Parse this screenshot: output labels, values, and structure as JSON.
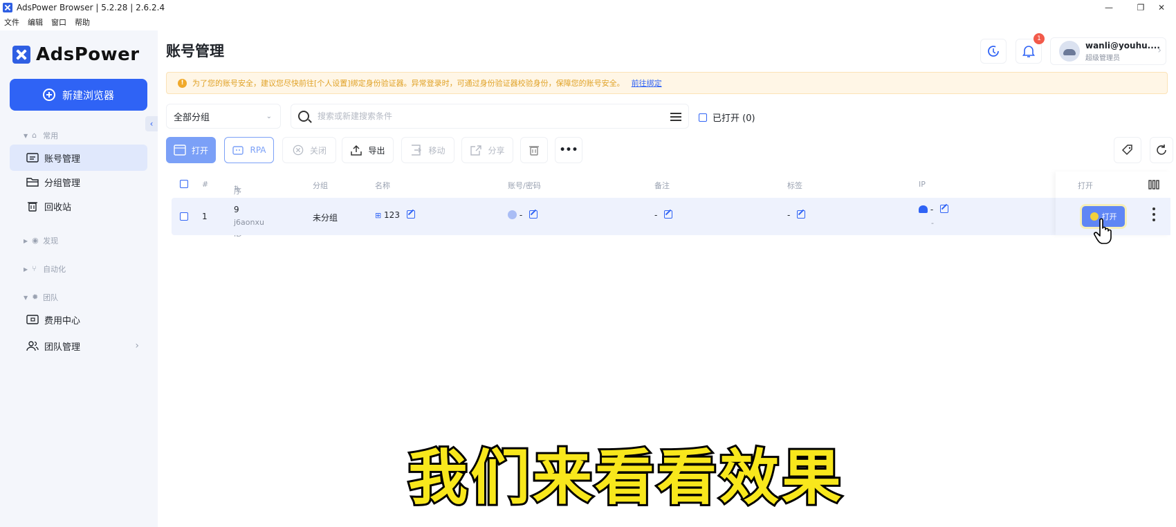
{
  "window": {
    "title": "AdsPower Browser | 5.2.28 | 2.6.2.4",
    "minimize": "—",
    "restore": "❐",
    "close": "✕"
  },
  "menu": [
    "文件",
    "编辑",
    "窗口",
    "帮助"
  ],
  "sidebar": {
    "brand": "AdsPower",
    "new_browser_label": "新建浏览器",
    "collapse_glyph": "‹",
    "sections": {
      "common": "常用",
      "discover": "发现",
      "automation": "自动化",
      "team": "团队"
    },
    "items": {
      "account_mgmt": "账号管理",
      "group_mgmt": "分组管理",
      "recycle_bin": "回收站",
      "billing": "费用中心",
      "team_mgmt": "团队管理"
    }
  },
  "header": {
    "page_title": "账号管理",
    "notification_count": "1",
    "user_name": "wanli@youhu....",
    "user_role": "超级管理员"
  },
  "notice": {
    "text": "为了您的账号安全，建议您尽快前往[个人设置]绑定身份验证器。异常登录时，可通过身份验证器校验身份，保障您的账号安全。",
    "link": "前往绑定"
  },
  "filters": {
    "group_select": "全部分组",
    "search_placeholder": "搜索或新建搜索条件",
    "opened_label": "已打开 (0)"
  },
  "toolbar": {
    "open": "打开",
    "rpa": "RPA",
    "close": "关闭",
    "export": "导出",
    "move": "移动",
    "share": "分享",
    "more": "•••"
  },
  "table": {
    "headers": {
      "index": "#",
      "serial": "序号/账号ID",
      "group": "分组",
      "name": "名称",
      "account": "账号/密码",
      "remark": "备注",
      "tag": "标签",
      "ip": "IP",
      "open": "打开"
    },
    "rows": [
      {
        "index": "1",
        "serial": "9",
        "account_id": "j6aonxu",
        "group": "未分组",
        "name": "123",
        "account": "-",
        "remark": "-",
        "tag": "-",
        "ip": "-",
        "ip_sub": "-",
        "open_label": "打开"
      }
    ]
  },
  "subtitle": "我们来看看效果",
  "colors": {
    "accent": "#2f63f5",
    "warning": "#f0a92a",
    "badge": "#f25a4a",
    "subtitle": "#f8e71c"
  }
}
